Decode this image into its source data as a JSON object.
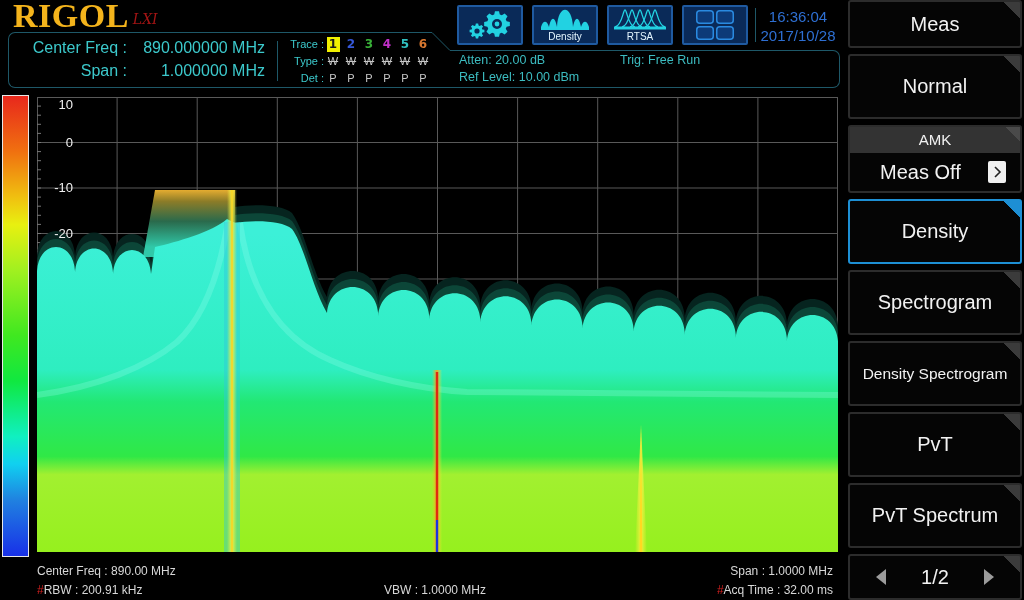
{
  "logo": {
    "brand": "RIGOL",
    "badge": "LXI"
  },
  "measurement": {
    "center_freq": {
      "label": "Center Freq :",
      "value": "890.000000 MHz"
    },
    "span": {
      "label": "Span :",
      "value": "1.000000 MHz"
    }
  },
  "traces": {
    "labels": {
      "trace": "Trace :",
      "type": "Type :",
      "det": "Det :"
    },
    "items": [
      {
        "number": "1",
        "color": "#f0f000",
        "selected": true,
        "type": "W",
        "type_struck": true,
        "det": "P"
      },
      {
        "number": "2",
        "color": "#3658d8",
        "selected": false,
        "type": "W",
        "type_struck": true,
        "det": "P"
      },
      {
        "number": "3",
        "color": "#38b038",
        "selected": false,
        "type": "W",
        "type_struck": true,
        "det": "P"
      },
      {
        "number": "4",
        "color": "#c030c8",
        "selected": false,
        "type": "W",
        "type_struck": true,
        "det": "P"
      },
      {
        "number": "5",
        "color": "#30c0c0",
        "selected": false,
        "type": "W",
        "type_struck": true,
        "det": "P"
      },
      {
        "number": "6",
        "color": "#d87830",
        "selected": false,
        "type": "W",
        "type_struck": true,
        "det": "P"
      }
    ]
  },
  "toolbar": [
    {
      "kind": "settings"
    },
    {
      "kind": "density",
      "label": "Density"
    },
    {
      "kind": "rtsa",
      "label": "RTSA"
    },
    {
      "kind": "layout"
    }
  ],
  "clock": {
    "time": "16:36:04",
    "date": "2017/10/28"
  },
  "settings": {
    "left": [
      "Atten: 20.00 dB",
      "Ref Level: 10.00 dBm"
    ],
    "right": [
      "Trig: Free Run"
    ]
  },
  "plot": {
    "y_labels": [
      "10",
      "0",
      "-10",
      "-20"
    ]
  },
  "footer": [
    {
      "left": {
        "text": "Center Freq : 890.00 MHz"
      },
      "right": {
        "text": "Span : 1.0000 MHz"
      }
    },
    {
      "left": {
        "mark": "#",
        "text": "RBW : 200.91 kHz"
      },
      "center": {
        "text": "VBW : 1.0000 MHz"
      },
      "right": {
        "mark": "#",
        "text": "Acq Time : 32.00 ms"
      }
    }
  ],
  "softkeys": [
    {
      "kind": "title",
      "label": "Meas",
      "selected": false
    },
    {
      "kind": "button",
      "label": "Normal",
      "selected": false
    },
    {
      "kind": "select",
      "title": "AMK",
      "value": "Meas Off",
      "selected": false
    },
    {
      "kind": "button",
      "label": "Density",
      "selected": true
    },
    {
      "kind": "button",
      "label": "Spectrogram",
      "selected": false
    },
    {
      "kind": "button",
      "label": "Density Spectrogram",
      "selected": false
    },
    {
      "kind": "button",
      "label": "PvT",
      "selected": false
    },
    {
      "kind": "button",
      "label": "PvT Spectrum",
      "selected": false
    },
    {
      "kind": "pager",
      "page": "1/2",
      "selected": false
    }
  ]
}
